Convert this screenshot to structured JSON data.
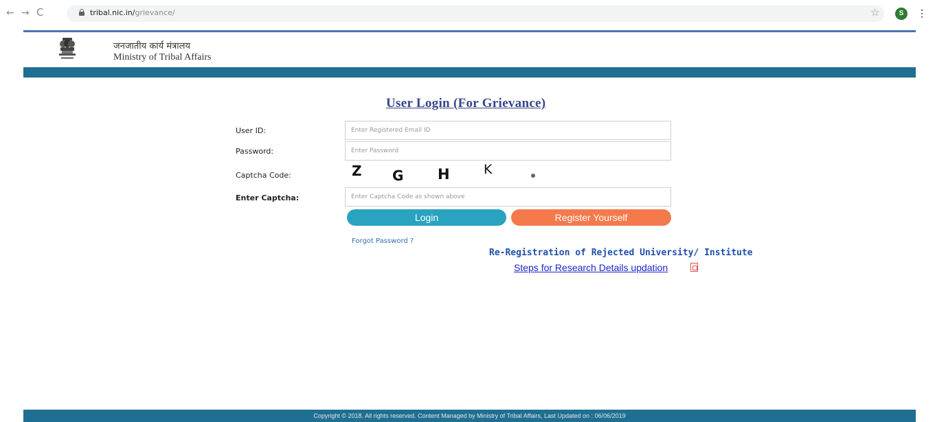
{
  "browser": {
    "back_icon": "arrow-left-icon",
    "forward_icon": "arrow-right-icon",
    "reload_icon": "reload-icon",
    "url_host": "tribal.nic.in/",
    "url_path": "grievance/",
    "profile_initial": "S",
    "profile_color": "#2e7d32"
  },
  "header": {
    "hindi_name": "जनजातीय कार्य मंत्रालय",
    "english_name": "Ministry of Tribal Affairs",
    "band_color": "#1e6f92",
    "rule_color": "#4b72b4"
  },
  "form": {
    "title": "User Login (For Grievance)",
    "user_id_label": "User ID:",
    "user_id_placeholder": "Enter Registered Email ID",
    "user_id_value": "",
    "password_label": "Password:",
    "password_placeholder": "Enter Password",
    "password_value": "",
    "captcha_label": "Captcha Code:",
    "captcha_chars": [
      "Z",
      "G",
      "H",
      "K"
    ],
    "enter_captcha_label": "Enter Captcha:",
    "captcha_placeholder": "Enter Captcha Code as shown above",
    "captcha_value": "",
    "login_label": "Login",
    "register_label": "Register Yourself",
    "login_color": "#2aa3c1",
    "register_color": "#f47a4c",
    "forgot_password": "Forgot Password ?"
  },
  "links": {
    "reregistration": "Re-Registration of Rejected University/ Institute",
    "steps": "Steps for Research Details updation",
    "steps_icon": "pdf-icon"
  },
  "footer": {
    "text": "Copyright © 2018. All rights reserved. Content Managed by Ministry of Tribal Affairs, Last Updated on : 06/06/2019"
  }
}
